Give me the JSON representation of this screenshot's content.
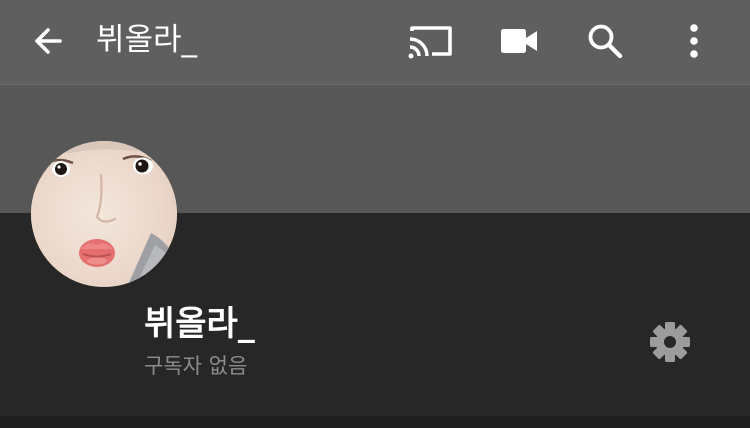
{
  "header": {
    "title": "뷔올라_",
    "icons": {
      "back": "arrow-left-icon",
      "cast": "cast-icon",
      "camera": "video-camera-icon",
      "search": "search-icon",
      "menu": "more-vertical-icon"
    }
  },
  "channel": {
    "name": "뷔올라_",
    "subscribers": "구독자 없음",
    "settings_icon": "gear-icon"
  },
  "colors": {
    "toolbar": "#5f5f5f",
    "banner": "#575757",
    "background": "#272727",
    "primary_text": "#ffffff",
    "secondary_text": "#8c8c8c",
    "icon": "#ffffff",
    "settings_icon": "#9c9c9c"
  }
}
